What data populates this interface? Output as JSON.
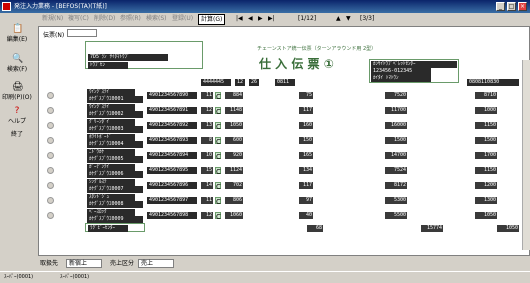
{
  "window": {
    "title": "発注入力業務 - [BEFOS(TA)(T紙)]",
    "controls": [
      "_",
      "□",
      "×"
    ]
  },
  "sidebar": [
    {
      "label": "編集(E)",
      "icon": "edit-icon"
    },
    {
      "label": "検索(F)",
      "icon": "search-icon"
    },
    {
      "label": "印刷(P)(O)",
      "icon": "print-icon"
    },
    {
      "label": "ヘルプ",
      "icon": "help-icon"
    },
    {
      "label": "終了",
      "icon": "exit-icon"
    }
  ],
  "menu": {
    "items": [
      "新規(N)",
      "複写(C)",
      "削除(D)",
      "参照(R)",
      "検索(S)",
      "登録(U)",
      "計算(G)"
    ],
    "nav": [
      "|◀",
      "◀",
      "▶",
      "▶|"
    ],
    "page": "[1/12]",
    "sub": "[3/3]"
  },
  "form": {
    "slip_no_label": "伝票(N)",
    "header_left": [
      "7D5ﾞﾗﾝ ｻｲﾀﾏﾄｳﾌﾞ",
      "ﾄｳﾌﾞｾﾝ"
    ],
    "title_small": "チェーンストア統一伝票（ターンアラウンド用 2型）",
    "title_big": "仕 入 伝 票 ①",
    "vendor": [
      "ｶﾝｻｲﾄｳﾌﾞﾍﾟﾚｯﾄｾﾝﾀｰ",
      "123456-012345",
      "ｶｲﾀｲ ﾄﾏﾄｳﾝ"
    ],
    "order_no": "4444445",
    "dept": "12",
    "code": "26",
    "date": "0811",
    "date2": "0808110830",
    "footer_label": "ﾗｸﾞﾋﾞｰｾﾝﾀｰ",
    "total_qty": "68",
    "total_cost": "15774",
    "total_price": "1050",
    "rows": [
      {
        "name": "ｳｲﾝｸﾞｽﾃｲ",
        "sub": "ｶｹｸﾞｽﾌﾞｳｴ0001",
        "jan": "4901234567890",
        "qty": "11",
        "unit": "C",
        "cost": "884",
        "price": "75",
        "amt": "7520",
        "sale": "8710"
      },
      {
        "name": "ｳｲﾝｸﾞｽﾃｲ",
        "sub": "ｶｹｸﾞｽﾌﾞｳｴ0002",
        "jan": "4901234567891",
        "qty": "12",
        "unit": "C",
        "cost": "1148",
        "price": "117",
        "amt": "11700",
        "sale": "1000"
      },
      {
        "name": "ｸﾞﾘｰﾝﾀﾞｲ",
        "sub": "ｶｹｸﾞｽﾌﾞｳｴ0003",
        "jan": "4901234567892",
        "qty": "13",
        "unit": "C",
        "cost": "1050",
        "price": "160",
        "amt": "16000",
        "sale": "1150"
      },
      {
        "name": "ﾎﾜｲﾄﾎﾞｰﾄﾞ",
        "sub": "ｶｹｸﾞｽﾌﾞｳｴ0004",
        "jan": "4901234567893",
        "qty": "8",
        "unit": "C",
        "cost": "600",
        "price": "150",
        "amt": "1500",
        "sale": "1500"
      },
      {
        "name": "ﾆﾄﾞｳｶｹ",
        "sub": "ｶｹｸﾞｽﾌﾞｳｴ0005",
        "jan": "4901234567894",
        "qty": "10",
        "unit": "C",
        "cost": "920",
        "price": "165",
        "amt": "14700",
        "sale": "1700"
      },
      {
        "name": "ｶﾞｰﾃﾞﾝﾃｲ",
        "sub": "ｶｹｸﾞｽﾌﾞｳｴ0006",
        "jan": "4901234567895",
        "qty": "15",
        "unit": "C",
        "cost": "1124",
        "price": "134",
        "amt": "7524",
        "sale": "1150"
      },
      {
        "name": "ｼﾝｸﾞﾙｽﾃ",
        "sub": "ｶｹｸﾞｽﾌﾞｳｴ0007",
        "jan": "4901234567896",
        "qty": "14",
        "unit": "C",
        "cost": "702",
        "price": "117",
        "amt": "8172",
        "sale": "1200"
      },
      {
        "name": "ｽﾀﾝﾄﾞｼﾞｭ",
        "sub": "ｶｹｸﾞｽﾌﾞｳｴ0008",
        "jan": "4901234567897",
        "qty": "11",
        "unit": "C",
        "cost": "806",
        "price": "97",
        "amt": "5300",
        "sale": "1300"
      },
      {
        "name": "ﾍﾞｰｽﾛｯｸ",
        "sub": "ｶｹｸﾞｽﾌﾞｳｴ0009",
        "jan": "4901234567898",
        "qty": "12",
        "unit": "C",
        "cost": "1060",
        "price": "40",
        "amt": "5500",
        "sale": "1050"
      }
    ]
  },
  "filter": {
    "label1": "取扱先",
    "val1": "新宿上",
    "label2": "売上区分",
    "val2": "売上"
  },
  "status": [
    "ｽｰﾊﾟｰ(0001)",
    "ｽｰﾊﾟｰ(0001)"
  ]
}
